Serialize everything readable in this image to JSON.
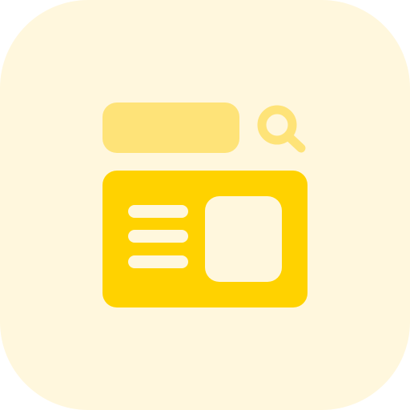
{
  "icon": {
    "name": "search-results-icon",
    "colors": {
      "background": "#FFF7DD",
      "search_bar": "#FEE378",
      "search_glass": "#FEE378",
      "card": "#FFD200",
      "card_content": "#FFF7DD"
    },
    "text_line_count": 3
  }
}
